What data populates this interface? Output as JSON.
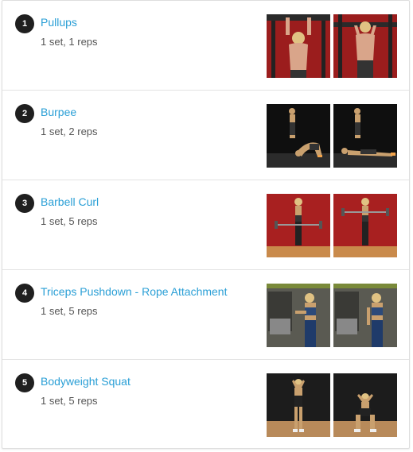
{
  "exercises": [
    {
      "number": "1",
      "name": "Pullups",
      "detail": "1 set, 1 reps",
      "images": [
        "pullups-start-photo",
        "pullups-end-photo"
      ]
    },
    {
      "number": "2",
      "name": "Burpee",
      "detail": "1 set, 2 reps",
      "images": [
        "burpee-start-photo",
        "burpee-end-photo"
      ]
    },
    {
      "number": "3",
      "name": "Barbell Curl",
      "detail": "1 set, 5 reps",
      "images": [
        "barbell-curl-start-photo",
        "barbell-curl-end-photo"
      ]
    },
    {
      "number": "4",
      "name": "Triceps Pushdown - Rope Attachment",
      "detail": "1 set, 5 reps",
      "images": [
        "triceps-pushdown-start-photo",
        "triceps-pushdown-end-photo"
      ]
    },
    {
      "number": "5",
      "name": "Bodyweight Squat",
      "detail": "1 set, 5 reps",
      "images": [
        "bodyweight-squat-start-photo",
        "bodyweight-squat-end-photo"
      ]
    }
  ],
  "colors": {
    "link": "#2a9fd6",
    "badge": "#1f1f1f",
    "detail_text": "#555555",
    "divider": "#e3e3e3"
  }
}
